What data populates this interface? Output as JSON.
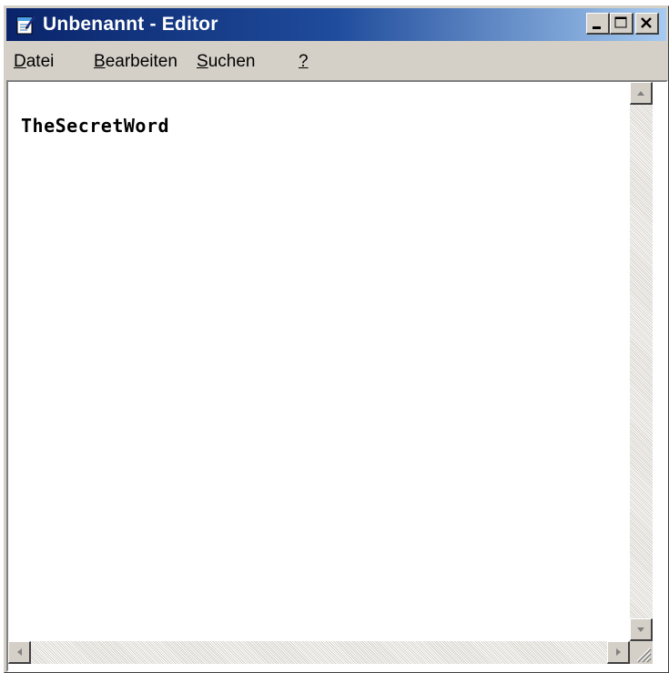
{
  "window": {
    "title": "Unbenannt - Editor",
    "app_icon": "notepad-icon",
    "controls": [
      "minimize-icon",
      "maximize-icon",
      "close-icon"
    ]
  },
  "menu": {
    "items": [
      {
        "key": "D",
        "rest": "atei"
      },
      {
        "key": "B",
        "rest": "earbeiten"
      },
      {
        "key": "S",
        "rest": "uchen"
      },
      {
        "key": "?",
        "rest": ""
      }
    ]
  },
  "editor": {
    "content": "TheSecretWord"
  },
  "scrollbars": {
    "icons": [
      "arrow-up-icon",
      "arrow-down-icon",
      "arrow-left-icon",
      "arrow-right-icon",
      "resize-grip-icon"
    ]
  },
  "colors": {
    "titlebar_start": "#0a246a",
    "titlebar_end": "#a6caf0",
    "face": "#d4d0c8"
  }
}
